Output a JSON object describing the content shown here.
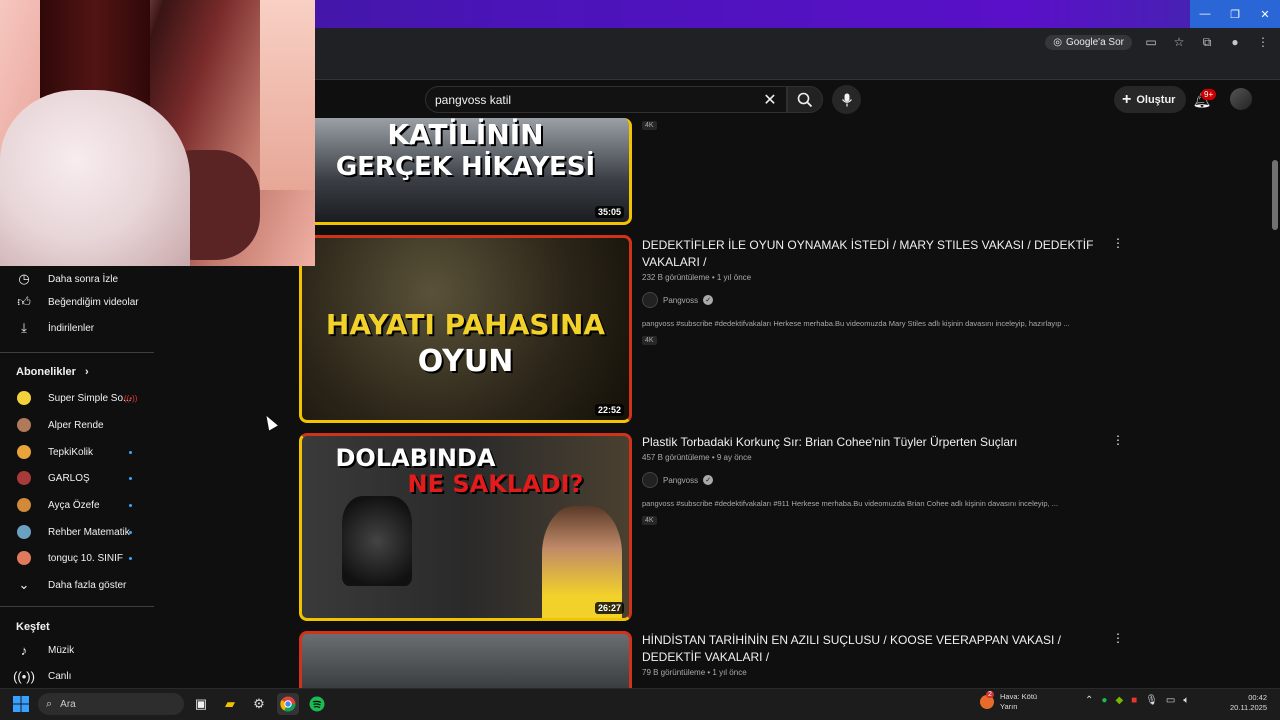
{
  "browser": {
    "ask_google_label": "Google'a Sor",
    "window_controls": [
      "—",
      "❐",
      "✕"
    ]
  },
  "youtube": {
    "search_value": "pangvoss katil",
    "create_label": "Oluştur",
    "notifications_badge": "9+"
  },
  "sidebar": {
    "items": [
      {
        "icon": "clock-icon",
        "label": "Daha sonra İzle"
      },
      {
        "icon": "thumbs-up-icon",
        "label": "Beğendiğim videolar"
      },
      {
        "icon": "download-icon",
        "label": "İndirilenler"
      }
    ],
    "subs_header": "Abonelikler",
    "subscriptions": [
      {
        "name": "Super Simple So...",
        "color": "#f2d13a",
        "status": "live"
      },
      {
        "name": "Alper Rende",
        "color": "#b07a5a",
        "status": ""
      },
      {
        "name": "TepkiKolik",
        "color": "#e8a33a",
        "status": "new"
      },
      {
        "name": "GARLOŞ",
        "color": "#a83a3a",
        "status": "new"
      },
      {
        "name": "Ayça Özefe",
        "color": "#d08a3a",
        "status": "new"
      },
      {
        "name": "Rehber Matematik",
        "color": "#6aa0c0",
        "status": "new"
      },
      {
        "name": "tonguç 10. SINIF",
        "color": "#e07a5a",
        "status": "new"
      }
    ],
    "show_more": "Daha fazla göster",
    "explore_header": "Keşfet",
    "explore": [
      {
        "icon": "music-note-icon",
        "label": "Müzik"
      },
      {
        "icon": "live-icon",
        "label": "Canlı"
      }
    ]
  },
  "results": [
    {
      "thumb_lines": [
        "KATİLİNİN",
        "GERÇEK HİKAYESİ"
      ],
      "duration": "35:05",
      "badge": "4K"
    },
    {
      "title": "DEDEKTİFLER İLE OYUN OYNAMAK İSTEDİ / MARY STILES VAKASI / DEDEKTİF VAKALARI /",
      "meta": "232 B görüntüleme • 1 yıl önce",
      "channel": "Pangvoss",
      "desc": "pangvoss #subscribe #dedektifvakaları Herkese merhaba.Bu videomuzda Mary Stiles adlı kişinin davasını inceleyip, hazırlayıp ...",
      "badge": "4K",
      "thumb_lines": [
        "HAYATI PAHASINA",
        "OYUN"
      ],
      "duration": "22:52"
    },
    {
      "title": "Plastik Torbadaki Korkunç Sır: Brian Cohee'nin Tüyler Ürperten Suçları",
      "meta": "457 B görüntüleme • 9 ay önce",
      "channel": "Pangvoss",
      "desc": "pangvoss #subscribe #dedektifvakaları #911 Herkese merhaba.Bu videomuzda Brian Cohee adlı kişinin davasını inceleyip, ...",
      "badge": "4K",
      "thumb_lines": [
        "DOLABINDA",
        "NE SAKLADI?"
      ],
      "duration": "26:27"
    },
    {
      "title": "HİNDİSTAN TARİHİNİN EN AZILI SUÇLUSU / KOOSE VEERAPPAN VAKASI / DEDEKTİF VAKALARI /",
      "meta": "79 B görüntüleme • 1 yıl önce"
    }
  ],
  "taskbar": {
    "search_label": "Ara",
    "weather_line1": "Hava: Kötü",
    "weather_line2": "Yarın",
    "weather_badge": "2",
    "time": "00:42",
    "date": "20.11.2025"
  }
}
